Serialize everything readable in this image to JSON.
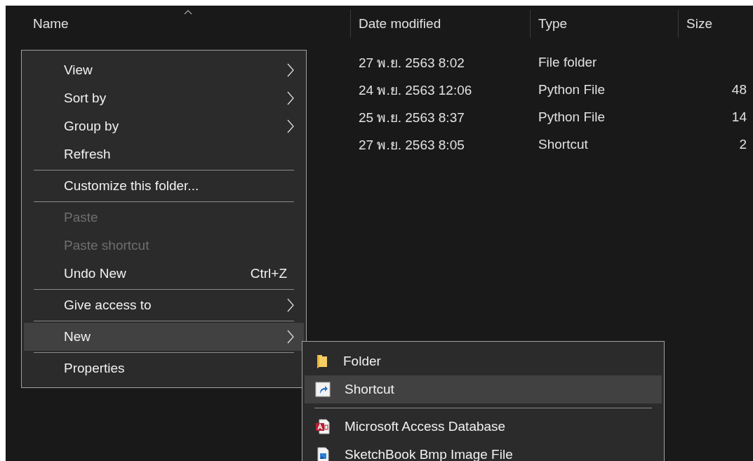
{
  "header": {
    "columns": [
      {
        "label": "Name",
        "sorted": true
      },
      {
        "label": "Date modified",
        "sorted": false
      },
      {
        "label": "Type",
        "sorted": false
      },
      {
        "label": "Size",
        "sorted": false
      }
    ]
  },
  "rows": [
    {
      "date": "27 พ.ย. 2563 8:02",
      "type": "File folder",
      "size": ""
    },
    {
      "date": "24 พ.ย. 2563 12:06",
      "type": "Python File",
      "size": "48"
    },
    {
      "date": "25 พ.ย. 2563 8:37",
      "type": "Python File",
      "size": "14"
    },
    {
      "date": "27 พ.ย. 2563 8:05",
      "type": "Shortcut",
      "size": "2"
    }
  ],
  "context_menu": {
    "items": [
      {
        "kind": "item",
        "label": "View",
        "submenu": true,
        "disabled": false,
        "selected": false
      },
      {
        "kind": "item",
        "label": "Sort by",
        "submenu": true,
        "disabled": false,
        "selected": false
      },
      {
        "kind": "item",
        "label": "Group by",
        "submenu": true,
        "disabled": false,
        "selected": false
      },
      {
        "kind": "item",
        "label": "Refresh",
        "submenu": false,
        "disabled": false,
        "selected": false
      },
      {
        "kind": "separator"
      },
      {
        "kind": "item",
        "label": "Customize this folder...",
        "submenu": false,
        "disabled": false,
        "selected": false
      },
      {
        "kind": "separator"
      },
      {
        "kind": "item",
        "label": "Paste",
        "submenu": false,
        "disabled": true,
        "selected": false
      },
      {
        "kind": "item",
        "label": "Paste shortcut",
        "submenu": false,
        "disabled": true,
        "selected": false
      },
      {
        "kind": "item",
        "label": "Undo New",
        "shortcut": "Ctrl+Z",
        "submenu": false,
        "disabled": false,
        "selected": false
      },
      {
        "kind": "separator"
      },
      {
        "kind": "item",
        "label": "Give access to",
        "submenu": true,
        "disabled": false,
        "selected": false
      },
      {
        "kind": "separator"
      },
      {
        "kind": "item",
        "label": "New",
        "submenu": true,
        "disabled": false,
        "selected": true
      },
      {
        "kind": "separator"
      },
      {
        "kind": "item",
        "label": "Properties",
        "submenu": false,
        "disabled": false,
        "selected": false
      }
    ]
  },
  "new_submenu": {
    "items": [
      {
        "kind": "folder",
        "label": "Folder",
        "selected": false
      },
      {
        "kind": "shortcut",
        "label": "Shortcut",
        "selected": true
      },
      {
        "kind": "separator"
      },
      {
        "kind": "database",
        "label": "Microsoft Access Database",
        "selected": false
      },
      {
        "kind": "image",
        "label": "SketchBook Bmp Image File",
        "selected": false
      }
    ]
  }
}
